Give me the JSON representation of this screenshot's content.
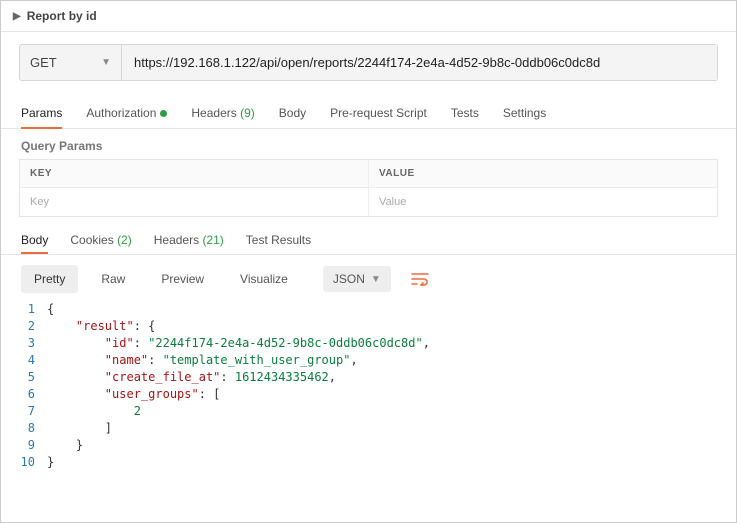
{
  "header": {
    "title": "Report by id"
  },
  "request": {
    "method": "GET",
    "url": "https://192.168.1.122/api/open/reports/2244f174-2e4a-4d52-9b8c-0ddb06c0dc8d",
    "tabs": {
      "params": "Params",
      "authorization": "Authorization",
      "headers_label": "Headers",
      "headers_count": "(9)",
      "body": "Body",
      "prerequest": "Pre-request Script",
      "tests": "Tests",
      "settings": "Settings"
    },
    "query_params": {
      "title": "Query Params",
      "head_key": "KEY",
      "head_value": "VALUE",
      "ph_key": "Key",
      "ph_value": "Value"
    }
  },
  "response": {
    "tabs": {
      "body": "Body",
      "cookies_label": "Cookies",
      "cookies_count": "(2)",
      "headers_label": "Headers",
      "headers_count": "(21)",
      "test_results": "Test Results"
    },
    "toolbar": {
      "pretty": "Pretty",
      "raw": "Raw",
      "preview": "Preview",
      "visualize": "Visualize",
      "format": "JSON"
    },
    "body_json": {
      "result": {
        "id": "2244f174-2e4a-4d52-9b8c-0ddb06c0dc8d",
        "name": "template_with_user_group",
        "create_file_at": 1612434335462,
        "user_groups": [
          2
        ]
      }
    },
    "body_display": {
      "l1": "{",
      "l2_k": "\"result\"",
      "l2_p": ": {",
      "l3_k": "\"id\"",
      "l3_p": ": ",
      "l3_v": "\"2244f174-2e4a-4d52-9b8c-0ddb06c0dc8d\"",
      "l3_e": ",",
      "l4_k": "\"name\"",
      "l4_p": ": ",
      "l4_v": "\"template_with_user_group\"",
      "l4_e": ",",
      "l5_k": "\"create_file_at\"",
      "l5_p": ": ",
      "l5_v": "1612434335462",
      "l5_e": ",",
      "l6_k": "\"user_groups\"",
      "l6_p": ": [",
      "l7_v": "2",
      "l8": "]",
      "l9": "}",
      "l10": "}"
    }
  }
}
